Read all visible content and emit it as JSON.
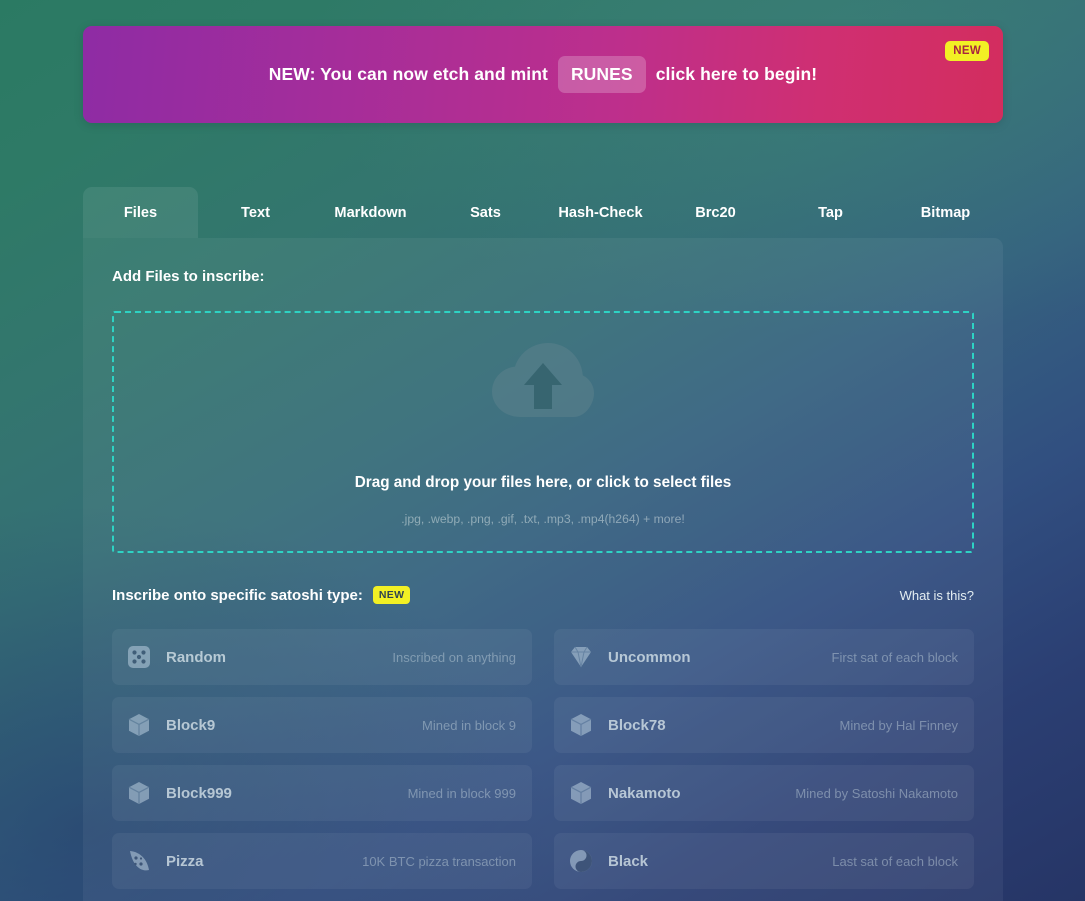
{
  "banner": {
    "prefix": "NEW: You can now etch and mint",
    "pill": "RUNES",
    "suffix": "click here to begin!",
    "badge": "NEW",
    "gradient_from": "#8e2ca4",
    "gradient_to": "#d32d5e",
    "badge_color": "#f2f024"
  },
  "tabs": [
    {
      "label": "Files",
      "active": true
    },
    {
      "label": "Text",
      "active": false
    },
    {
      "label": "Markdown",
      "active": false
    },
    {
      "label": "Sats",
      "active": false
    },
    {
      "label": "Hash-Check",
      "active": false
    },
    {
      "label": "Brc20",
      "active": false
    },
    {
      "label": "Tap",
      "active": false
    },
    {
      "label": "Bitmap",
      "active": false
    }
  ],
  "files_panel": {
    "add_files_label": "Add Files to inscribe:",
    "dropzone": {
      "icon": "cloud-upload-icon",
      "primary_text": "Drag and drop your files here, or click to select files",
      "secondary_text": ".jpg, .webp, .png, .gif, .txt, .mp3, .mp4(h264) + more!",
      "border_color": "#2ed3c4"
    },
    "sat_section": {
      "title": "Inscribe onto specific satoshi type:",
      "badge": "NEW",
      "help_link": "What is this?",
      "options": [
        {
          "icon": "dice-icon",
          "name": "Random",
          "desc": "Inscribed on anything"
        },
        {
          "icon": "gem-icon",
          "name": "Uncommon",
          "desc": "First sat of each block"
        },
        {
          "icon": "cube-icon",
          "name": "Block9",
          "desc": "Mined in block 9"
        },
        {
          "icon": "cube-icon",
          "name": "Block78",
          "desc": "Mined by Hal Finney"
        },
        {
          "icon": "cube-icon",
          "name": "Block999",
          "desc": "Mined in block 999"
        },
        {
          "icon": "cube-icon",
          "name": "Nakamoto",
          "desc": "Mined by Satoshi Nakamoto"
        },
        {
          "icon": "pizza-icon",
          "name": "Pizza",
          "desc": "10K BTC pizza transaction"
        },
        {
          "icon": "yinyang-icon",
          "name": "Black",
          "desc": "Last sat of each block"
        }
      ]
    }
  }
}
